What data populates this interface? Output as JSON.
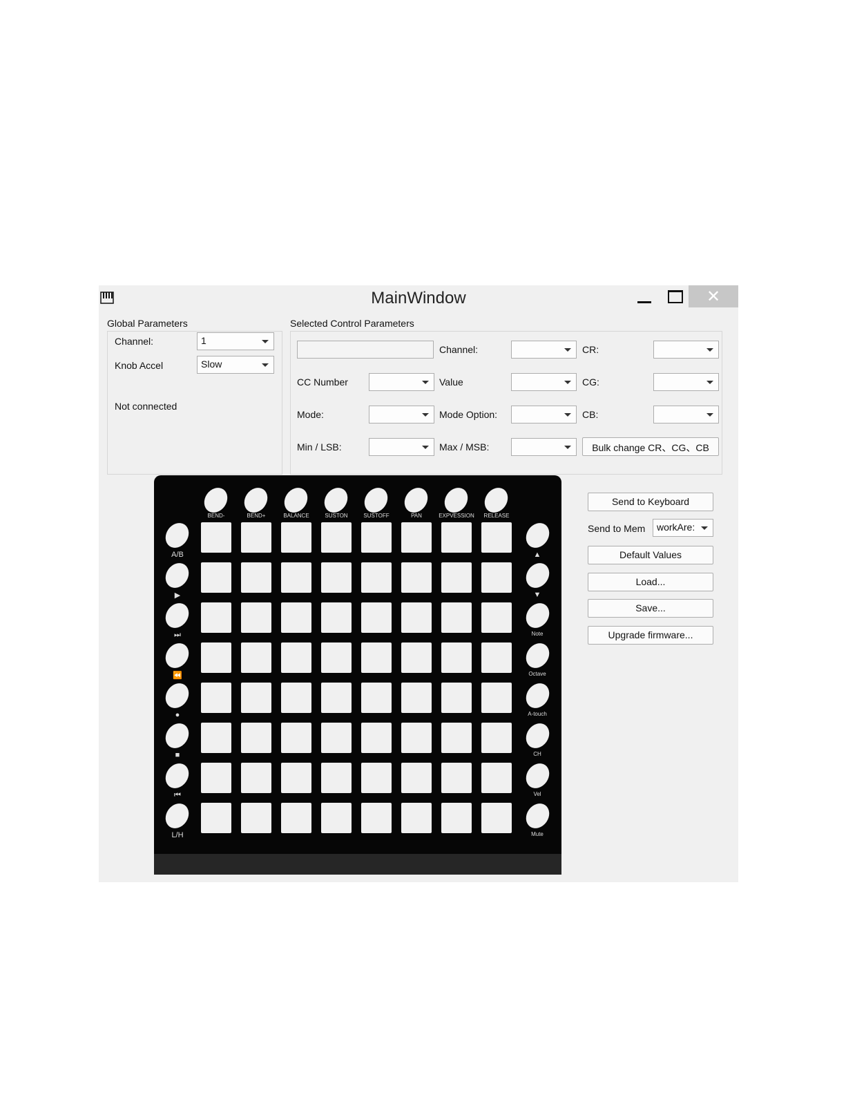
{
  "window": {
    "title": "MainWindow",
    "close_glyph": "✕"
  },
  "global": {
    "group_label": "Global Parameters",
    "channel_label": "Channel:",
    "channel_value": "1",
    "knob_accel_label": "Knob Accel",
    "knob_accel_value": "Slow",
    "status": "Not connected"
  },
  "selected": {
    "group_label": "Selected Control Parameters",
    "channel_label": "Channel:",
    "cr_label": "CR:",
    "cc_number_label": "CC Number",
    "value_label": "Value",
    "cg_label": "CG:",
    "mode_label": "Mode:",
    "mode_option_label": "Mode Option:",
    "cb_label": "CB:",
    "min_lsb_label": "Min / LSB:",
    "max_msb_label": "Max / MSB:",
    "bulk_button": "Bulk change CR、CG、CB"
  },
  "actions": {
    "send_to_keyboard": "Send to Keyboard",
    "send_to_mem_label": "Send to Mem",
    "send_to_mem_value": "workAre:",
    "default_values": "Default Values",
    "load": "Load...",
    "save": "Save...",
    "upgrade_firmware": "Upgrade firmware..."
  },
  "device": {
    "top_labels": [
      "BEND-",
      "BEND+",
      "BALANCE",
      "SUSTON",
      "SUSTOFF",
      "PAN",
      "EXPVESSION",
      "RELEASE"
    ],
    "left_labels": [
      "A/B",
      "▶",
      "⏭",
      "⏪",
      "●",
      "■",
      "⏮",
      "L/H"
    ],
    "right_labels": [
      "▲",
      "▼",
      "Note",
      "Octave",
      "A-touch",
      "CH",
      "Vel",
      "Mute"
    ],
    "grid_rows": 8,
    "grid_cols": 8
  }
}
